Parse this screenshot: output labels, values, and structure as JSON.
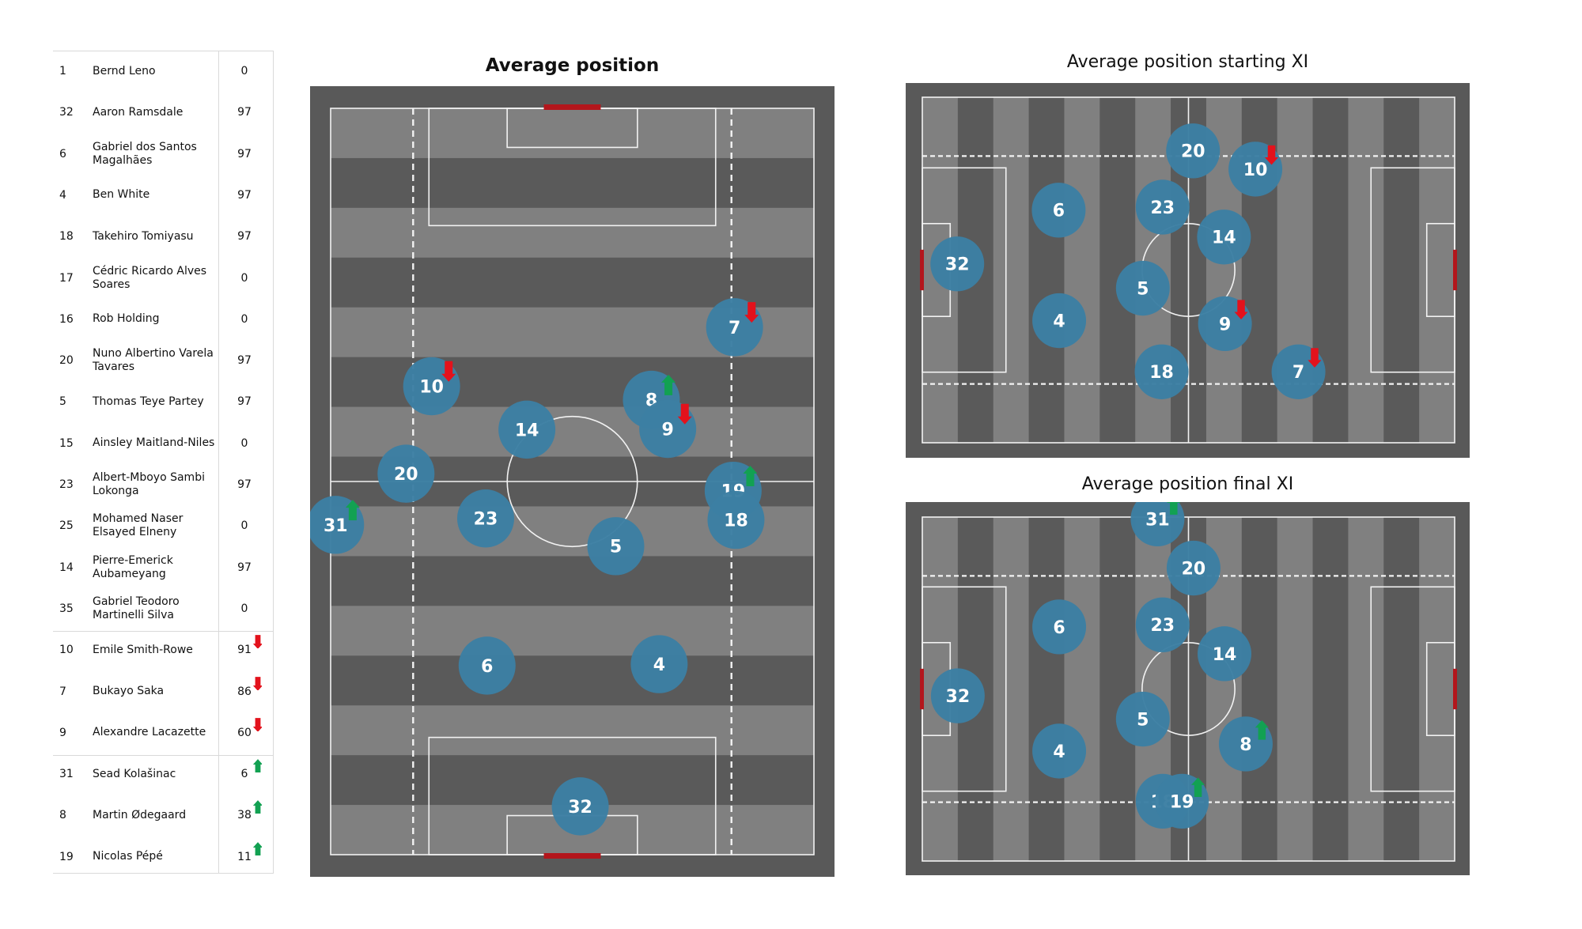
{
  "chart_data": [
    {
      "type": "table",
      "title": "",
      "columns": [
        "shirt_number",
        "player_name",
        "minutes"
      ],
      "groups": [
        "starters_full_or_unused",
        "subbed_off",
        "subbed_on"
      ],
      "rows": [
        {
          "number": "1",
          "name": "Bernd Leno",
          "minutes": "0",
          "change": "none",
          "group": 0
        },
        {
          "number": "32",
          "name": "Aaron Ramsdale",
          "minutes": "97",
          "change": "none",
          "group": 0
        },
        {
          "number": "6",
          "name": "Gabriel dos Santos Magalhães",
          "minutes": "97",
          "change": "none",
          "group": 0
        },
        {
          "number": "4",
          "name": "Ben White",
          "minutes": "97",
          "change": "none",
          "group": 0
        },
        {
          "number": "18",
          "name": "Takehiro Tomiyasu",
          "minutes": "97",
          "change": "none",
          "group": 0
        },
        {
          "number": "17",
          "name": "Cédric Ricardo Alves Soares",
          "minutes": "0",
          "change": "none",
          "group": 0
        },
        {
          "number": "16",
          "name": "Rob Holding",
          "minutes": "0",
          "change": "none",
          "group": 0
        },
        {
          "number": "20",
          "name": "Nuno Albertino Varela Tavares",
          "minutes": "97",
          "change": "none",
          "group": 0
        },
        {
          "number": "5",
          "name": "Thomas Teye Partey",
          "minutes": "97",
          "change": "none",
          "group": 0
        },
        {
          "number": "15",
          "name": "Ainsley Maitland-Niles",
          "minutes": "0",
          "change": "none",
          "group": 0
        },
        {
          "number": "23",
          "name": "Albert-Mboyo Sambi Lokonga",
          "minutes": "97",
          "change": "none",
          "group": 0
        },
        {
          "number": "25",
          "name": "Mohamed Naser Elsayed Elneny",
          "minutes": "0",
          "change": "none",
          "group": 0
        },
        {
          "number": "14",
          "name": "Pierre-Emerick Aubameyang",
          "minutes": "97",
          "change": "none",
          "group": 0
        },
        {
          "number": "35",
          "name": "Gabriel Teodoro Martinelli Silva",
          "minutes": "0",
          "change": "none",
          "group": 0
        },
        {
          "number": "10",
          "name": "Emile Smith-Rowe",
          "minutes": "91",
          "change": "off",
          "group": 1
        },
        {
          "number": "7",
          "name": "Bukayo Saka",
          "minutes": "86",
          "change": "off",
          "group": 1
        },
        {
          "number": "9",
          "name": "Alexandre Lacazette",
          "minutes": "60",
          "change": "off",
          "group": 1
        },
        {
          "number": "31",
          "name": "Sead Kolašinac",
          "minutes": "6",
          "change": "on",
          "group": 2
        },
        {
          "number": "8",
          "name": "Martin Ødegaard",
          "minutes": "38",
          "change": "on",
          "group": 2
        },
        {
          "number": "19",
          "name": "Nicolas Pépé",
          "minutes": "11",
          "change": "on",
          "group": 2
        }
      ]
    },
    {
      "type": "scatter",
      "id": "main",
      "title": "Average position",
      "orientation": "vertical",
      "pitch_length_m": 105,
      "pitch_width_m": 68,
      "players": [
        {
          "number": "7",
          "x": 56.8,
          "y": 74.2,
          "change": "off"
        },
        {
          "number": "10",
          "x": 14.2,
          "y": 65.9,
          "change": "off"
        },
        {
          "number": "8",
          "x": 45.1,
          "y": 64.0,
          "change": "on"
        },
        {
          "number": "9",
          "x": 47.4,
          "y": 59.9,
          "change": "off"
        },
        {
          "number": "14",
          "x": 27.6,
          "y": 59.8,
          "change": "none"
        },
        {
          "number": "20",
          "x": 10.6,
          "y": 53.6,
          "change": "none"
        },
        {
          "number": "19",
          "x": 56.6,
          "y": 51.2,
          "change": "on"
        },
        {
          "number": "31",
          "x": 0.7,
          "y": 46.4,
          "change": "on"
        },
        {
          "number": "23",
          "x": 21.8,
          "y": 47.3,
          "change": "none"
        },
        {
          "number": "18",
          "x": 57.0,
          "y": 47.1,
          "change": "none"
        },
        {
          "number": "5",
          "x": 40.1,
          "y": 43.4,
          "change": "none"
        },
        {
          "number": "6",
          "x": 22.0,
          "y": 26.6,
          "change": "none"
        },
        {
          "number": "4",
          "x": 46.2,
          "y": 26.8,
          "change": "none"
        },
        {
          "number": "32",
          "x": 35.1,
          "y": 6.8,
          "change": "none"
        }
      ]
    },
    {
      "type": "scatter",
      "id": "start",
      "title": "Average position starting XI",
      "orientation": "horizontal",
      "pitch_length_m": 105,
      "pitch_width_m": 68,
      "players": [
        {
          "number": "20",
          "x": 53.4,
          "y": 57.6,
          "change": "none"
        },
        {
          "number": "10",
          "x": 65.7,
          "y": 54.0,
          "change": "off"
        },
        {
          "number": "6",
          "x": 26.9,
          "y": 45.9,
          "change": "none"
        },
        {
          "number": "23",
          "x": 47.4,
          "y": 46.5,
          "change": "none"
        },
        {
          "number": "14",
          "x": 59.5,
          "y": 40.6,
          "change": "none"
        },
        {
          "number": "32",
          "x": 6.9,
          "y": 35.3,
          "change": "none"
        },
        {
          "number": "5",
          "x": 43.5,
          "y": 30.5,
          "change": "none"
        },
        {
          "number": "4",
          "x": 27.0,
          "y": 24.1,
          "change": "none"
        },
        {
          "number": "9",
          "x": 59.7,
          "y": 23.5,
          "change": "off"
        },
        {
          "number": "18",
          "x": 47.2,
          "y": 14.0,
          "change": "none"
        },
        {
          "number": "7",
          "x": 74.2,
          "y": 14.0,
          "change": "off"
        }
      ]
    },
    {
      "type": "scatter",
      "id": "final",
      "title": "Average position final XI",
      "orientation": "horizontal",
      "pitch_length_m": 105,
      "pitch_width_m": 68,
      "players": [
        {
          "number": "31",
          "x": 46.4,
          "y": 67.5,
          "change": "on"
        },
        {
          "number": "20",
          "x": 53.5,
          "y": 57.8,
          "change": "none"
        },
        {
          "number": "6",
          "x": 27.0,
          "y": 46.2,
          "change": "none"
        },
        {
          "number": "23",
          "x": 47.4,
          "y": 46.6,
          "change": "none"
        },
        {
          "number": "14",
          "x": 59.6,
          "y": 40.9,
          "change": "none"
        },
        {
          "number": "32",
          "x": 7.0,
          "y": 32.6,
          "change": "none"
        },
        {
          "number": "5",
          "x": 43.5,
          "y": 28.0,
          "change": "none"
        },
        {
          "number": "8",
          "x": 63.8,
          "y": 23.1,
          "change": "on"
        },
        {
          "number": "4",
          "x": 27.0,
          "y": 21.7,
          "change": "none"
        },
        {
          "number": "18",
          "x": 47.4,
          "y": 11.8,
          "change": "none"
        },
        {
          "number": "19",
          "x": 51.2,
          "y": 11.8,
          "change": "on"
        }
      ]
    }
  ],
  "colors": {
    "pitch_outer": "#595959",
    "stripe_light": "#808080",
    "stripe_dark": "#5a5a5a",
    "line": "#f2f2f2",
    "goal": "#b3161c",
    "player": "#3c7fa3",
    "arrow_off": "#e3121c",
    "arrow_on": "#12a152"
  }
}
